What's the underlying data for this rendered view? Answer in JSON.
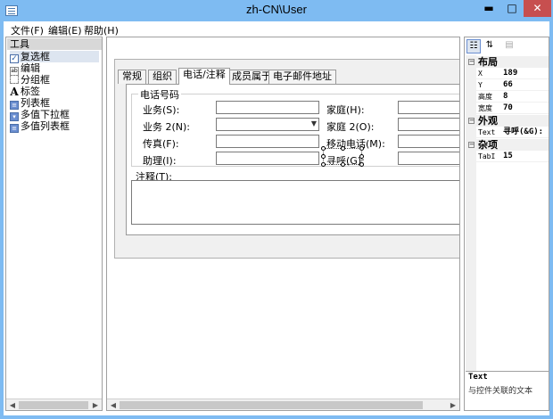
{
  "window": {
    "title": "zh-CN\\User",
    "min_glyph": "▬",
    "max_glyph": "□",
    "close_glyph": "✕"
  },
  "menu": [
    "文件(F)",
    "编辑(E)",
    "帮助(H)"
  ],
  "toolbox": {
    "header": "工具",
    "items": [
      {
        "label": "复选框",
        "icon": "checkbox-icon"
      },
      {
        "label": "编辑",
        "icon": "textbox-icon"
      },
      {
        "label": "分组框",
        "icon": "groupbox-icon"
      },
      {
        "label": "标签",
        "icon": "label-icon"
      },
      {
        "label": "列表框",
        "icon": "listbox-icon"
      },
      {
        "label": "多值下拉框",
        "icon": "multi-dropdown-icon"
      },
      {
        "label": "多值列表框",
        "icon": "multi-listbox-icon"
      }
    ]
  },
  "form": {
    "tabs": [
      "常规",
      "组织",
      "电话/注释",
      "成员属于",
      "电子邮件地址"
    ],
    "active_tab": "电话/注释",
    "group_title": "电话号码",
    "fields": {
      "business": "业务(S):",
      "business2": "业务 2(N):",
      "fax": "传真(F):",
      "assistant": "助理(I):",
      "home": "家庭(H):",
      "home2": "家庭 2(O):",
      "mobile": "移动电话(M):",
      "pager": "寻呼(G):"
    },
    "notes_label": "注释(T):"
  },
  "properties": {
    "categories": {
      "layout": "布局",
      "appearance": "外观",
      "misc": "杂项"
    },
    "rows": {
      "x": {
        "name": "X",
        "value": "189"
      },
      "y": {
        "name": "Y",
        "value": "66"
      },
      "height": {
        "name": "高度",
        "value": "8"
      },
      "width": {
        "name": "宽度",
        "value": "70"
      },
      "text": {
        "name": "Text",
        "value": "寻呼(&G):"
      },
      "tabindex": {
        "name": "TabI",
        "value": "15"
      }
    },
    "description": {
      "title": "Text",
      "text": "与控件关联的文本"
    }
  }
}
